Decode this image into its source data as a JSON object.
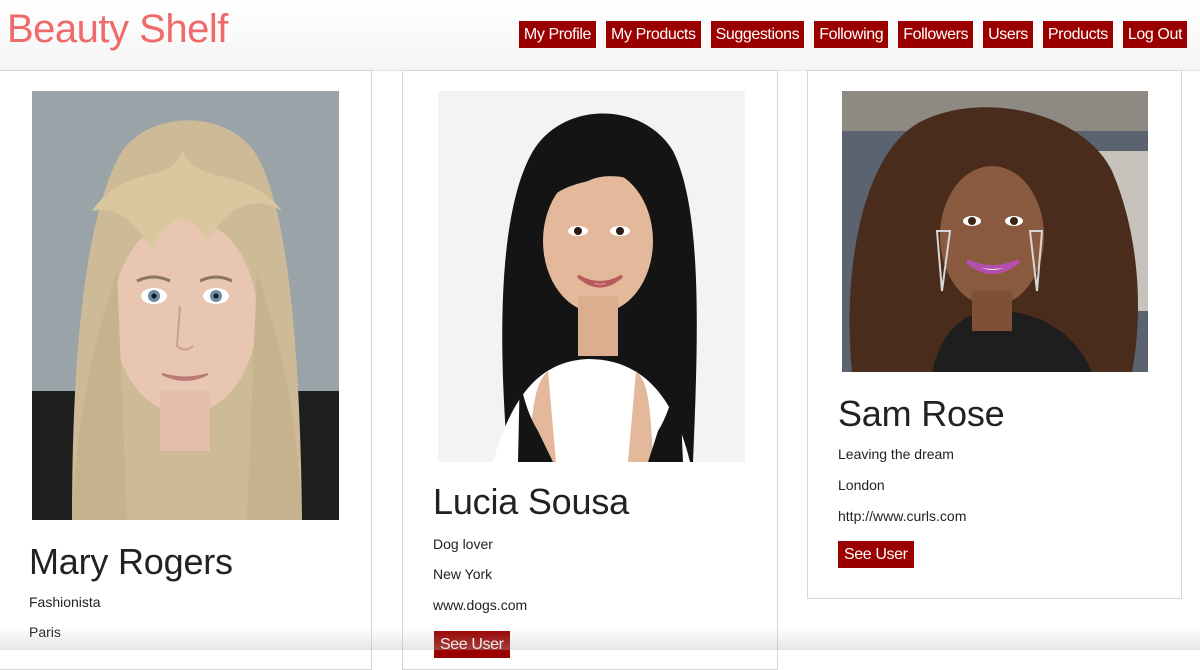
{
  "brand": {
    "title": "Beauty Shelf"
  },
  "nav": {
    "items": [
      {
        "label": "My Profile"
      },
      {
        "label": "My Products"
      },
      {
        "label": "Suggestions"
      },
      {
        "label": "Following"
      },
      {
        "label": "Followers"
      },
      {
        "label": "Users"
      },
      {
        "label": "Products"
      },
      {
        "label": "Log Out"
      }
    ]
  },
  "users": [
    {
      "name": "Mary Rogers",
      "bio": "Fashionista",
      "city": "Paris",
      "website": "",
      "button_label": "",
      "hair_color": "#cdbb97"
    },
    {
      "name": "Lucia Sousa",
      "bio": "Dog lover",
      "city": "New York",
      "website": "www.dogs.com",
      "button_label": "See User",
      "hair_color": "#141414"
    },
    {
      "name": "Sam Rose",
      "bio": "Leaving the dream",
      "city": "London",
      "website": "http://www.curls.com",
      "button_label": "See User",
      "hair_color": "#4a2c1c"
    }
  ],
  "colors": {
    "accent": "#9b0000",
    "brand": "#ef6a6a"
  }
}
